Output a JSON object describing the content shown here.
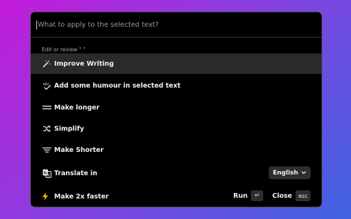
{
  "search": {
    "placeholder": "What to apply to the selected text?"
  },
  "section_label": "Edit or review \" \"",
  "items": [
    {
      "label": "Improve Writing",
      "icon": "magic-wand-icon",
      "active": true
    },
    {
      "label": "Add some humour in selected text",
      "icon": "spellcheck-icon",
      "active": false
    },
    {
      "label": "Make longer",
      "icon": "lines-long-icon",
      "active": false
    },
    {
      "label": "Simplify",
      "icon": "simplify-icon",
      "active": false
    },
    {
      "label": "Make Shorter",
      "icon": "lines-short-icon",
      "active": false
    },
    {
      "label": "Translate in",
      "icon": "translate-icon",
      "active": false
    }
  ],
  "translate": {
    "selected": "English"
  },
  "footer": {
    "label": "Make 2x faster",
    "icon": "lightning-icon",
    "run_label": "Run",
    "run_key": "↵",
    "close_label": "Close",
    "close_key": "esc"
  },
  "colors": {
    "panel": "#000000",
    "active_row": "#2a2a2a",
    "lightning": "#f5b400",
    "gradient_start": "#c21bd8",
    "gradient_end": "#3f63e0"
  }
}
